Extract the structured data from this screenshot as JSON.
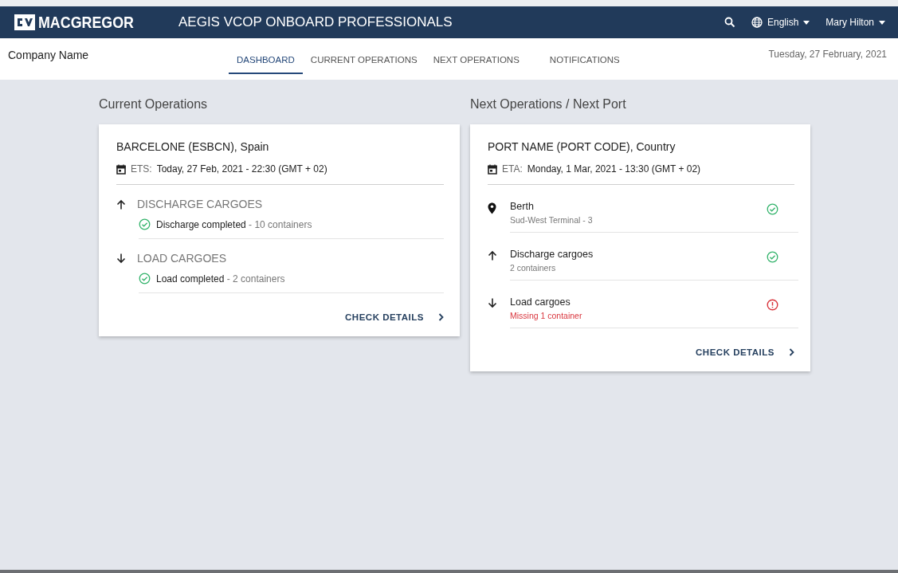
{
  "header": {
    "logo": "MACGREGOR",
    "title": "AEGIS VCOP ONBOARD PROFESSIONALS",
    "language": "English",
    "user": "Mary Hilton"
  },
  "subheader": {
    "company": "Company Name",
    "date": "Tuesday, 27 February, 2021",
    "tabs": [
      {
        "label": "DASHBOARD",
        "selected": true
      },
      {
        "label": "CURRENT OPERATIONS",
        "selected": false
      },
      {
        "label": "NEXT OPERATIONS",
        "selected": false
      },
      {
        "label": "NOTIFICATIONS",
        "selected": false
      }
    ]
  },
  "current": {
    "title": "Current Operations",
    "port": "BARCELONE (ESBCN), Spain",
    "date_label": "ETS:",
    "date_value": "Today, 27 Feb, 2021 - 22:30 (GMT + 02)",
    "sections": [
      {
        "kind": "up",
        "heading": "DISCHARGE CARGOES",
        "items": [
          {
            "alert": false,
            "label": "Discharge completed",
            "detail": " - 10 containers"
          }
        ]
      },
      {
        "kind": "down",
        "heading": "LOAD CARGOES",
        "items": [
          {
            "alert": false,
            "label": "Load completed",
            "detail": " - 2 containers"
          }
        ]
      }
    ],
    "link": "CHECK DETAILS"
  },
  "next": {
    "title": "Next Operations / Next Port",
    "port": "PORT NAME (PORT CODE), Country",
    "date_label": "ETA:",
    "date_value": "Monday, 1 Mar, 2021 - 13:30 (GMT + 02)",
    "rows": [
      {
        "kind": "pin",
        "title": "Berth",
        "subtitle": "Sud-West Terminal - 3",
        "alert": false
      },
      {
        "kind": "up",
        "title": "Discharge cargoes",
        "subtitle": "2 containers",
        "alert": false
      },
      {
        "kind": "down",
        "title": "Load cargoes",
        "subtitle": "Missing 1 container",
        "alert": true
      }
    ],
    "link": "CHECK DETAILS"
  }
}
